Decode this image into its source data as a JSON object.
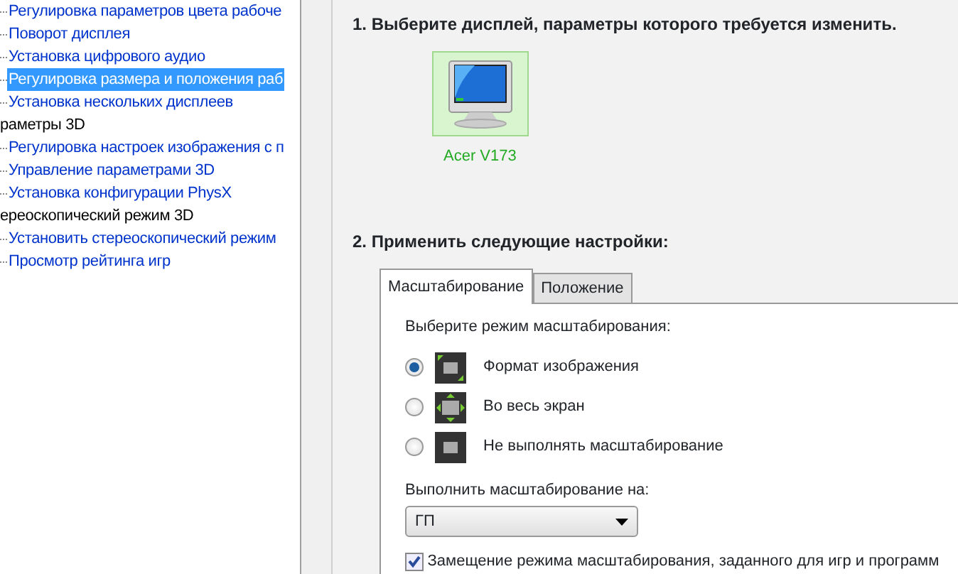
{
  "tree": [
    {
      "children": [
        {
          "label": "Регулировка параметров цвета рабоче",
          "selected": false
        },
        {
          "label": "Поворот дисплея",
          "selected": false
        },
        {
          "label": "Установка цифрового аудио",
          "selected": false
        },
        {
          "label": "Регулировка размера и положения раб",
          "selected": true
        },
        {
          "label": "Установка нескольких дисплеев",
          "selected": false
        }
      ]
    },
    {
      "label": "раметры 3D",
      "children": [
        {
          "label": "Регулировка настроек изображения с п",
          "selected": false
        },
        {
          "label": "Управление параметрами 3D",
          "selected": false
        },
        {
          "label": "Установка конфигурации PhysX",
          "selected": false
        }
      ]
    },
    {
      "label": "ереоскопический режим 3D",
      "children": [
        {
          "label": "Установить стереоскопический режим",
          "selected": false
        },
        {
          "label": "Просмотр рейтинга игр",
          "selected": false
        }
      ]
    }
  ],
  "step1": {
    "title": "1. Выберите дисплей, параметры которого требуется изменить.",
    "displays": [
      {
        "name": "Acer V173",
        "selected": true
      }
    ]
  },
  "step2": {
    "title": "2. Применить следующие настройки:",
    "tabs": [
      {
        "label": "Масштабирование",
        "selected": true
      },
      {
        "label": "Положение",
        "selected": false
      }
    ],
    "mode_label": "Выберите режим масштабирования:",
    "modes": [
      {
        "label": "Формат изображения",
        "kind": "aspect",
        "selected": true
      },
      {
        "label": "Во весь экран",
        "kind": "full",
        "selected": false
      },
      {
        "label": "Не выполнять масштабирование",
        "kind": "none",
        "selected": false
      }
    ],
    "target_label": "Выполнить масштабирование на:",
    "target": {
      "value": "ГП"
    },
    "override": {
      "label": "Замещение режима масштабирования, заданного для игр и программ",
      "checked": true
    }
  }
}
